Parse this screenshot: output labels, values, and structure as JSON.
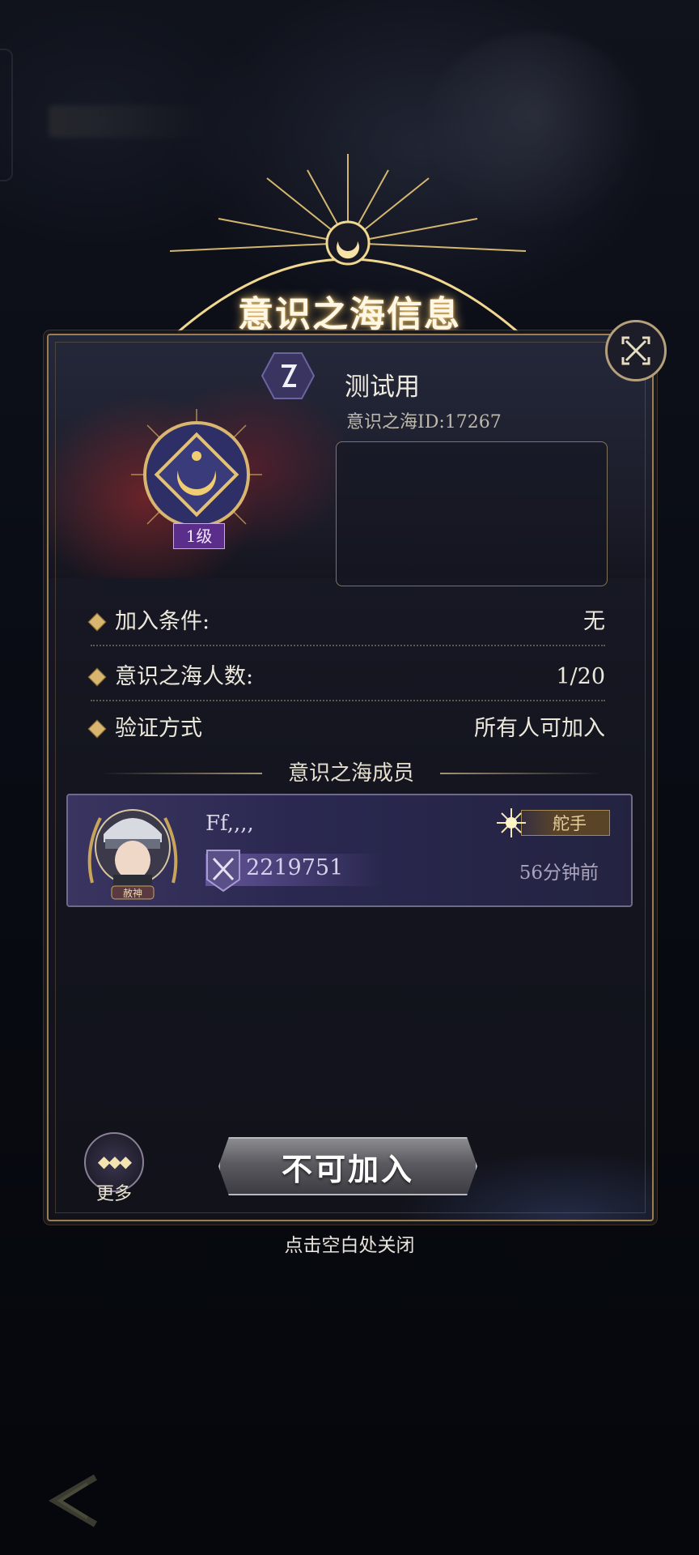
{
  "title": "意识之海信息",
  "sea": {
    "name": "测试用",
    "id_text": "意识之海ID:17267",
    "level": "1级",
    "description": ""
  },
  "info_rows": [
    {
      "label": "加入条件:",
      "value": "无"
    },
    {
      "label": "意识之海人数:",
      "value": "1/20"
    },
    {
      "label": "验证方式",
      "value": "所有人可加入"
    }
  ],
  "members_header": "意识之海成员",
  "members": [
    {
      "name": "Ff,,,,",
      "power": "2219751",
      "role": "舵手",
      "last_seen": "56分钟前",
      "title_badge": "赦神"
    }
  ],
  "buttons": {
    "more_label": "更多",
    "join_label": "不可加入",
    "close_hint": "点击空白处关闭"
  },
  "icons": [
    "close-icon",
    "crescent-emblem-icon",
    "hex-rune-icon",
    "crossed-swords-icon",
    "star-icon",
    "back-arrow-icon",
    "more-dots-icon"
  ],
  "colors": {
    "accent_gold": "#d8b670",
    "level_purple": "#5a2e8a",
    "panel_bg": "#14151f"
  }
}
